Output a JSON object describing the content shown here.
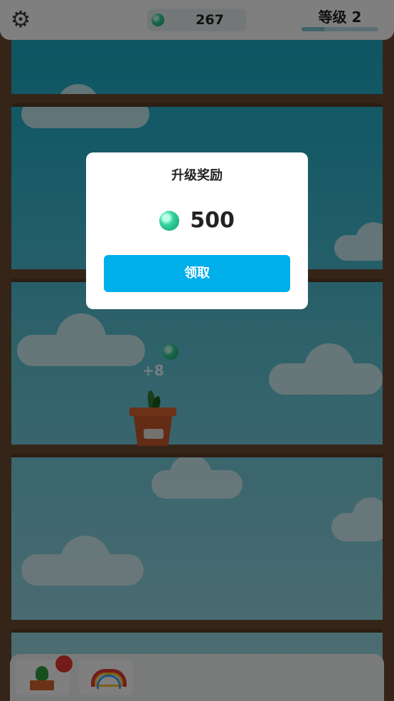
{
  "header": {
    "settings_icon": "gear-icon",
    "gem_icon": "green-gem-icon",
    "gem_count": "267",
    "level_label": "等级 2",
    "level_progress": 0.3
  },
  "scene": {
    "floating_reward": "+8",
    "plant": "potted-sprout"
  },
  "bottom_bar": {
    "items": [
      {
        "icon": "cactus-pot-icon",
        "has_badge": true
      },
      {
        "icon": "rainbow-icon",
        "has_badge": false
      }
    ]
  },
  "dialog": {
    "title": "升级奖励",
    "reward_icon": "green-gem-icon",
    "reward_amount": "500",
    "claim_label": "领取"
  },
  "colors": {
    "accent_button": "#00aeea",
    "shelf_wood": "#6b4a33",
    "badge_red": "#e53935"
  }
}
